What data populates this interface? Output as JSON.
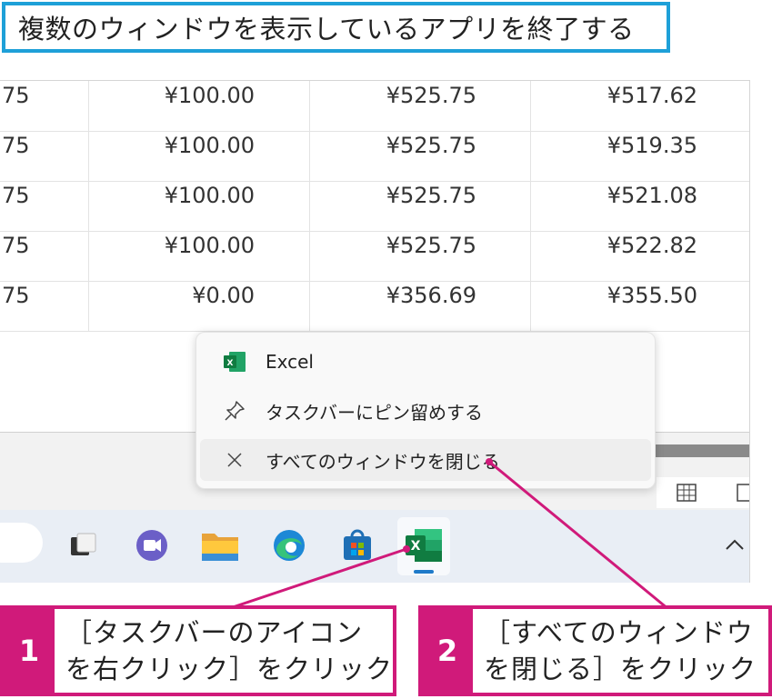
{
  "heading": "複数のウィンドウを表示しているアプリを終了する",
  "sheet": {
    "rows": [
      [
        "75",
        "¥100.00",
        "¥525.75",
        "¥517.62"
      ],
      [
        "75",
        "¥100.00",
        "¥525.75",
        "¥519.35"
      ],
      [
        "75",
        "¥100.00",
        "¥525.75",
        "¥521.08"
      ],
      [
        "75",
        "¥100.00",
        "¥525.75",
        "¥522.82"
      ],
      [
        "75",
        "¥0.00",
        "¥356.69",
        "¥355.50"
      ]
    ]
  },
  "context_menu": {
    "items": [
      {
        "label": "Excel",
        "icon": "excel-icon"
      },
      {
        "label": "タスクバーにピン留めする",
        "icon": "pin-icon"
      },
      {
        "label": "すべてのウィンドウを閉じる",
        "icon": "close-icon"
      }
    ]
  },
  "taskbar": {
    "icons": [
      "task-view-icon",
      "teams-chat-icon",
      "file-explorer-icon",
      "edge-icon",
      "store-icon",
      "excel-icon"
    ]
  },
  "callouts": [
    {
      "number": "1",
      "text": "［タスクバーのアイコン\nを右クリック］をクリック"
    },
    {
      "number": "2",
      "text": "［すべてのウィンドウ\nを閉じる］をクリック"
    }
  ],
  "colors": {
    "title_border": "#1ea0d8",
    "callout_accent": "#d01a7a",
    "excel_green": "#107c41"
  }
}
